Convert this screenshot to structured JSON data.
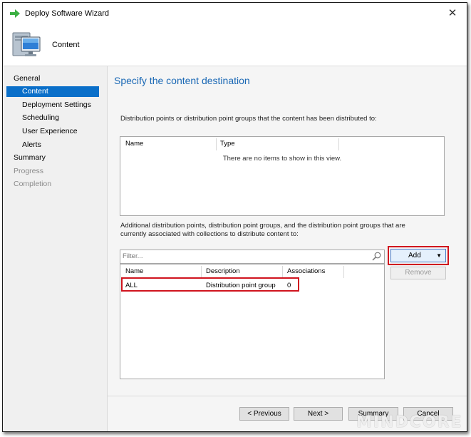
{
  "window": {
    "title": "Deploy Software Wizard",
    "close_glyph": "✕"
  },
  "header": {
    "title": "Content",
    "icon": "computer-icon"
  },
  "sidebar": {
    "items": [
      {
        "label": "General"
      },
      {
        "label": "Content"
      },
      {
        "label": "Deployment Settings"
      },
      {
        "label": "Scheduling"
      },
      {
        "label": "User Experience"
      },
      {
        "label": "Alerts"
      },
      {
        "label": "Summary"
      },
      {
        "label": "Progress"
      },
      {
        "label": "Completion"
      }
    ]
  },
  "main": {
    "page_title": "Specify the content destination",
    "distributed_description": "Distribution points or distribution point groups that the content has been distributed to:",
    "distributed_list": {
      "columns": [
        "Name",
        "Type"
      ],
      "empty_message": "There are no items to show in this view."
    },
    "additional_description": "Additional distribution points, distribution point groups, and the distribution point groups that are currently associated with collections to distribute content to:",
    "filter_placeholder": "Filter...",
    "additional_list": {
      "columns": [
        "Name",
        "Description",
        "Associations"
      ],
      "rows": [
        {
          "name": "ALL",
          "description": "Distribution point group",
          "associations": "0"
        }
      ]
    },
    "add_label": "Add",
    "remove_label": "Remove"
  },
  "footer": {
    "previous_label": "< Previous",
    "next_label": "Next >",
    "summary_label": "Summary",
    "cancel_label": "Cancel"
  },
  "watermark": "MINDCORE",
  "colors": {
    "accent": "#0a6fc9",
    "title_blue": "#1a68b5",
    "highlight_red": "#d0141e"
  }
}
